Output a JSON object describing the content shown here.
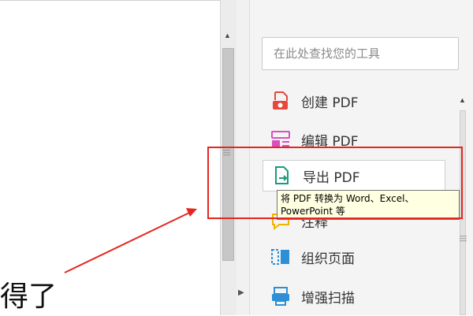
{
  "document": {
    "visible_text": "得了"
  },
  "tools_pane": {
    "search": {
      "placeholder": "在此处查找您的工具",
      "value": ""
    },
    "items": [
      {
        "label": "创建 PDF",
        "icon": "create-pdf-icon",
        "color": "#e8473b"
      },
      {
        "label": "编辑 PDF",
        "icon": "edit-pdf-icon",
        "color": "#d94fc1"
      },
      {
        "label": "导出 PDF",
        "icon": "export-pdf-icon",
        "color": "#1a9c7a"
      },
      {
        "label": "注释",
        "icon": "comment-icon",
        "color": "#f0b400"
      },
      {
        "label": "组织页面",
        "icon": "organize-pages-icon",
        "color": "#2e8fd6"
      },
      {
        "label": "增强扫描",
        "icon": "enhance-scans-icon",
        "color": "#2e8fd6"
      }
    ],
    "tooltip": "将 PDF 转换为 Word、Excel、PowerPoint 等"
  },
  "annotation": {
    "color": "#e52620"
  }
}
